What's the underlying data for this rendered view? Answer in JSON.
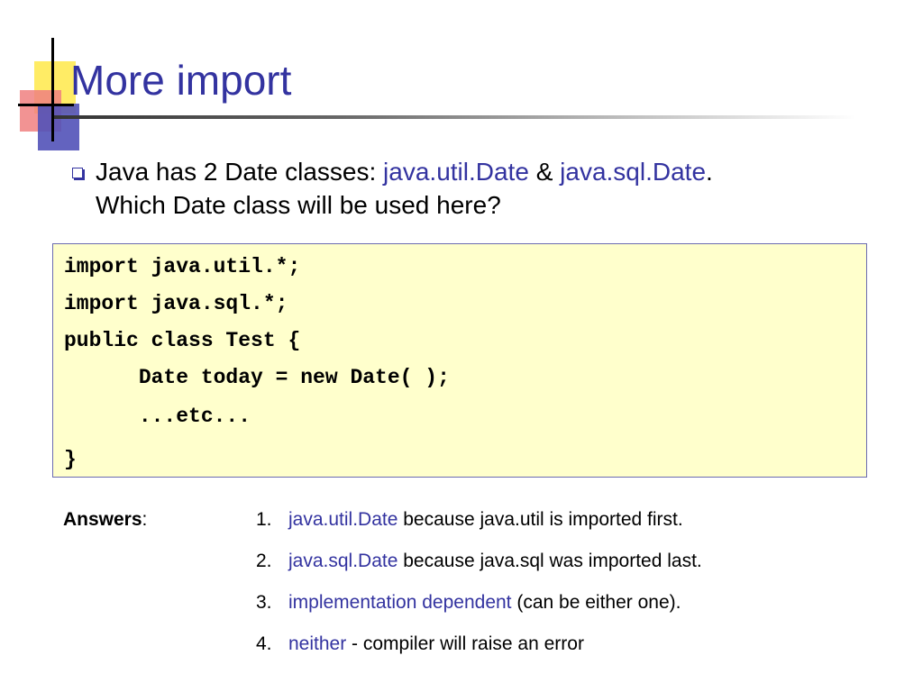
{
  "slide": {
    "title": "More import",
    "bullet": {
      "intro": "Java has 2 Date classes: ",
      "class1": "java.util.Date",
      "amp": " & ",
      "class2": "java.sql.Date",
      "period": ".",
      "question": "Which Date class will be used here?"
    },
    "code_lines": [
      "import java.util.*;",
      "import java.sql.*;",
      "public class Test {",
      "      Date today = new Date( );",
      "      ...etc...",
      "}"
    ],
    "answers": {
      "label": "Answers",
      "colon": ":",
      "items": [
        {
          "num": "1.",
          "highlight": "java.util.Date",
          "rest": " because java.util is imported first."
        },
        {
          "num": "2.",
          "highlight": "java.sql.Date",
          "rest": " because java.sql was imported last."
        },
        {
          "num": "3.",
          "highlight": "implementation dependent",
          "rest": " (can be either one)."
        },
        {
          "num": "4.",
          "highlight": "neither",
          "rest": " - compiler will raise an error"
        }
      ]
    }
  },
  "colors": {
    "title": "#3333a0",
    "highlight": "#3333a0",
    "code_background": "#ffffcc",
    "code_border": "#6b6bb0"
  }
}
